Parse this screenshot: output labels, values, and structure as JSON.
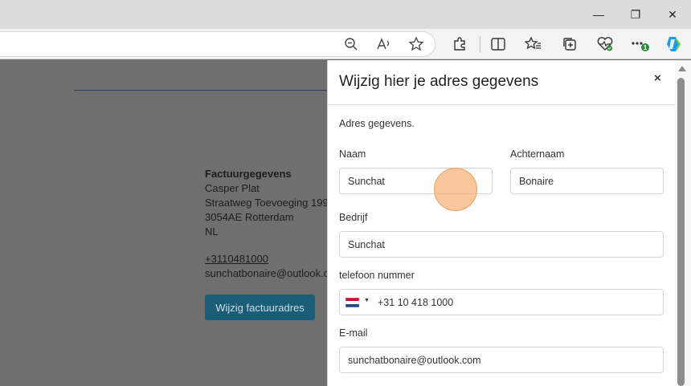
{
  "window": {
    "controls": {
      "minimize": "—",
      "restore": "❐",
      "close": "✕"
    }
  },
  "toolbar": {
    "icons": [
      "zoom-out-icon",
      "read-aloud-icon",
      "favorite-star-icon",
      "extensions-icon",
      "split-screen-icon",
      "favorites-icon",
      "collections-icon",
      "browser-essentials-icon",
      "more-icon",
      "copilot-icon"
    ],
    "more_badge": "1"
  },
  "page": {
    "billing": {
      "heading": "Factuurgegevens",
      "name": "Casper Plat",
      "street": "Straatweg Toevoeging 199",
      "city": "3054AE Rotterdam",
      "country": "NL",
      "phone": "+3110481000",
      "email": "sunchatbonaire@outlook.com"
    },
    "edit_button_label": "Wijzig factuuradres"
  },
  "modal": {
    "title": "Wijzig hier je adres gegevens",
    "close_label": "×",
    "intro": "Adres gegevens.",
    "fields": {
      "first_name": {
        "label": "Naam",
        "value": "Sunchat"
      },
      "last_name": {
        "label": "Achternaam",
        "value": "Bonaire"
      },
      "company": {
        "label": "Bedrijf",
        "value": "Sunchat"
      },
      "phone": {
        "label": "telefoon nummer",
        "value": "+31 10 418 1000",
        "country_caret": "▼"
      },
      "email": {
        "label": "E-mail",
        "value": "sunchatbonaire@outlook.com"
      }
    }
  },
  "colors": {
    "overlay": "#6f6f6f",
    "button": "#1a5d78",
    "cursor_highlight": "#f6b274"
  }
}
